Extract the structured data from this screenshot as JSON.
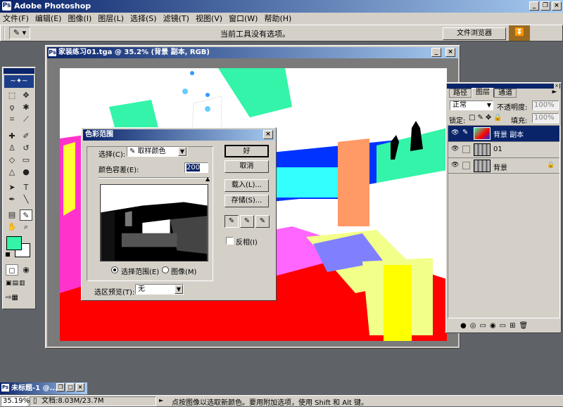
{
  "app": {
    "title": "Adobe Photoshop"
  },
  "menu": [
    "文件(F)",
    "编辑(E)",
    "图像(I)",
    "图层(L)",
    "选择(S)",
    "滤镜(T)",
    "视图(V)",
    "窗口(W)",
    "帮助(H)"
  ],
  "options": {
    "hint": "当前工具没有选项。",
    "file_browser": "文件浏览器"
  },
  "doc": {
    "title": "家装练习01.tga @ 35.2% (背景 副本, RGB)"
  },
  "dialog": {
    "title": "色彩范围",
    "select_label": "选择(C):",
    "select_value": "取样颜色",
    "fuzziness_label": "颜色容差(E):",
    "fuzziness_value": "200",
    "radio_selection": "选择范围(E)",
    "radio_image": "图像(M)",
    "preview_label": "选区预览(T):",
    "preview_value": "无",
    "ok": "好",
    "cancel": "取消",
    "load": "载入(L)...",
    "save": "存储(S)...",
    "invert": "反相(I)"
  },
  "layers": {
    "tabs": [
      "路径",
      "图层",
      "通道"
    ],
    "blend": "正常",
    "opacity_label": "不透明度:",
    "opacity": "100%",
    "lock_label": "锁定:",
    "fill_label": "填充:",
    "fill": "100%",
    "items": [
      {
        "name": "背景 副本"
      },
      {
        "name": "01"
      },
      {
        "name": "背景"
      }
    ]
  },
  "minimized": {
    "title": "未标题-1 @..."
  },
  "status": {
    "zoom": "35.19%",
    "doc": "文档:8.03M/23.7M",
    "hint": "点按图像以选取新颜色。要用附加选项，使用 Shift 和 Alt 键。"
  }
}
